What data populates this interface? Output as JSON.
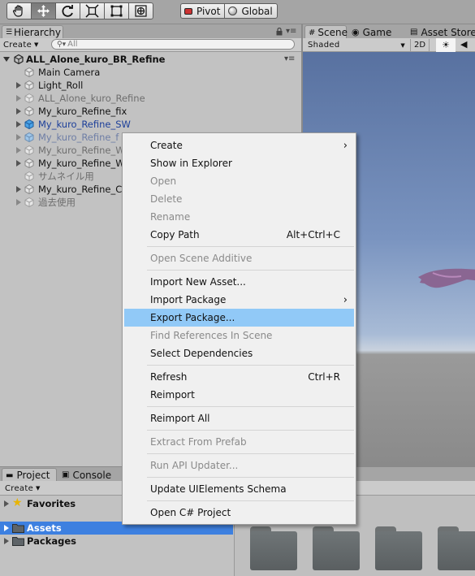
{
  "toolbar": {
    "tools": [
      "hand-icon",
      "move-icon",
      "rotate-icon",
      "scale-icon",
      "rect-icon",
      "transform-icon"
    ],
    "pivot": "Pivot",
    "global": "Global"
  },
  "hierarchy": {
    "tab": "Hierarchy",
    "create": "Create",
    "search_placeholder": "All",
    "scene_name": "ALL_Alone_kuro_BR_Refine",
    "items": [
      {
        "label": "Main Camera"
      },
      {
        "label": "Light_Roll"
      },
      {
        "label": "ALL_Alone_kuro_Refine"
      },
      {
        "label": "My_kuro_Refine_fix"
      },
      {
        "label": "My_kuro_Refine_SW"
      },
      {
        "label": "My_kuro_Refine_f"
      },
      {
        "label": "My_kuro_Refine_W"
      },
      {
        "label": "My_kuro_Refine_W"
      },
      {
        "label": "サムネイル用"
      },
      {
        "label": "My_kuro_Refine_C"
      },
      {
        "label": "過去使用"
      }
    ]
  },
  "scene": {
    "tabs": [
      "Scene",
      "Game",
      "Asset Store"
    ],
    "shading": "Shaded",
    "mode2d": "2D"
  },
  "project": {
    "tabs": [
      "Project",
      "Console"
    ],
    "create": "Create",
    "tree": [
      "Favorites",
      "Assets",
      "Packages"
    ]
  },
  "menu": {
    "items": [
      {
        "label": "Create"
      },
      {
        "label": "Show in Explorer"
      },
      {
        "label": "Open"
      },
      {
        "label": "Delete"
      },
      {
        "label": "Rename"
      },
      {
        "label": "Copy Path",
        "shortcut": "Alt+Ctrl+C"
      },
      {
        "label": "Open Scene Additive"
      },
      {
        "label": "Import New Asset..."
      },
      {
        "label": "Import Package"
      },
      {
        "label": "Export Package..."
      },
      {
        "label": "Find References In Scene"
      },
      {
        "label": "Select Dependencies"
      },
      {
        "label": "Refresh",
        "shortcut": "Ctrl+R"
      },
      {
        "label": "Reimport"
      },
      {
        "label": "Reimport All"
      },
      {
        "label": "Extract From Prefab"
      },
      {
        "label": "Run API Updater..."
      },
      {
        "label": "Update UIElements Schema"
      },
      {
        "label": "Open C# Project"
      }
    ]
  }
}
